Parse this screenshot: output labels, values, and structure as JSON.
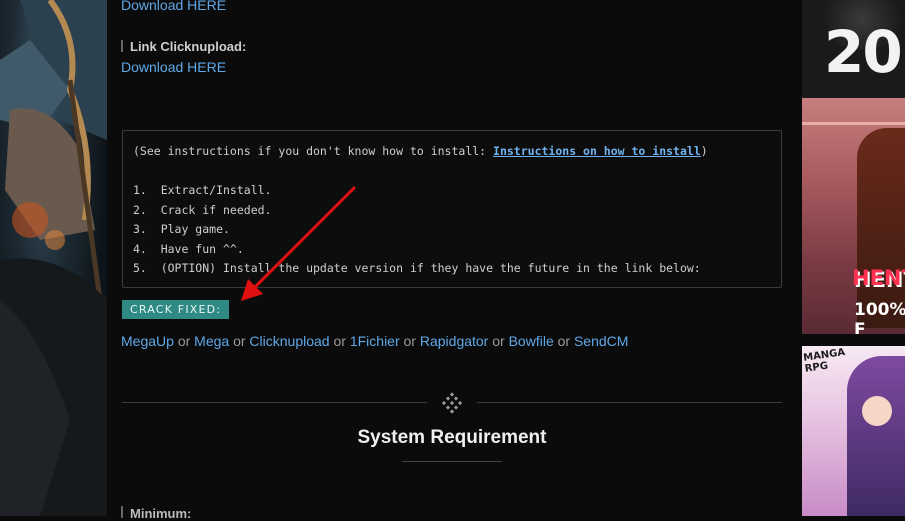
{
  "downloads": {
    "top_link": "Download HERE",
    "clicknupload_label": "Link Clicknupload:",
    "clicknupload_link": "Download HERE"
  },
  "instructions": {
    "intro_prefix": "(See instructions if you don't know how to install: ",
    "intro_link": "Instructions on how to install",
    "intro_suffix": ")",
    "steps": [
      "1.  Extract/Install.",
      "2.  Crack if needed.",
      "3.  Play game.",
      "4.  Have fun ^^.",
      "5.  (OPTION) Install the update version if they have the future in the link below:"
    ]
  },
  "crack": {
    "badge": "CRACK FIXED:",
    "hosts": [
      "MegaUp",
      "Mega",
      "Clicknupload",
      "1Fichier",
      "Rapidgator",
      "Bowfile",
      "SendCM"
    ],
    "separator": "or"
  },
  "system": {
    "title": "System Requirement",
    "minimum_label": "Minimum:"
  },
  "ads": {
    "banner1_text": "20",
    "banner2_text": "HENT",
    "banner2_sub": "100% F",
    "banner3_logo": "MANGA RPG"
  },
  "colors": {
    "link": "#5fa8e8",
    "badge_bg": "#2f8a84",
    "annotation_arrow": "#e01010"
  },
  "icons": {
    "divider": "diamond-dots-icon",
    "arrow": "red-arrow-annotation"
  }
}
